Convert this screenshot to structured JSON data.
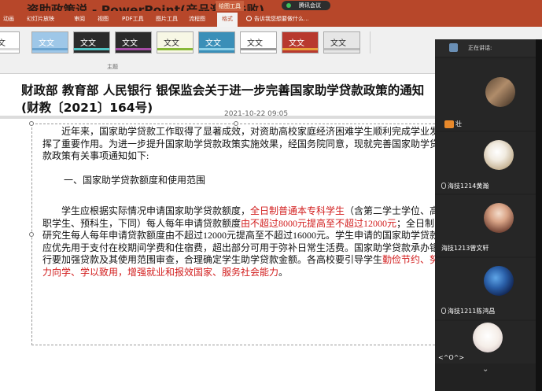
{
  "window": {
    "doc_title": "资助政策说 - PowerPoint(产品激活失败)",
    "context_tab": "绘图工具",
    "meeting_app": "腾讯会议"
  },
  "tabs": [
    {
      "label": "动画"
    },
    {
      "label": "幻灯片放映"
    },
    {
      "label": "审阅"
    },
    {
      "label": "视图"
    },
    {
      "label": "PDF工具"
    },
    {
      "label": "图片工具"
    },
    {
      "label": "流程图"
    },
    {
      "label": "格式"
    }
  ],
  "tell_me": "告诉我您想要做什么...",
  "ribbon": {
    "style_text": "文文",
    "group_label": "主题",
    "styles": [
      {
        "bg": "#ffffff",
        "fg": "#333333",
        "bar": "#d9d9d9"
      },
      {
        "bg": "#9ec7e8",
        "fg": "#ffffff",
        "bar": "#6aa3cf"
      },
      {
        "bg": "#2b2b2b",
        "fg": "#ffffff",
        "bar": "#4fc3c3"
      },
      {
        "bg": "#2b2b2b",
        "fg": "#ffffff",
        "bar": "#a64ca6"
      },
      {
        "bg": "#f7f7e5",
        "fg": "#333333",
        "bar": "#88b838"
      },
      {
        "bg": "#3a8fb8",
        "fg": "#ffffff",
        "bar": "#8cd0e8"
      },
      {
        "bg": "#ffffff",
        "fg": "#333333",
        "bar": "#999999"
      },
      {
        "bg": "#b8392e",
        "fg": "#ffffff",
        "bar": "#e8a03a"
      },
      {
        "bg": "#e6e6e6",
        "fg": "#333333",
        "bar": "#bbbbbb"
      }
    ]
  },
  "document": {
    "title": "财政部 教育部 人民银行 银保监会关于进一步完善国家助学贷款政策的通知(财教〔2021〕164号)",
    "date": "2021-10-22 09:05",
    "para1": "近年来，国家助学贷款工作取得了显著成效，对资助高校家庭经济困难学生顺利完成学业发挥了重要作用。为进一步提升国家助学贷款政策实施效果，经国务院同意，现就完善国家助学贷款政策有关事项通知如下:",
    "section1": "一、国家助学贷款额度和使用范围",
    "p2_a": "学生应根据实际情况申请国家助学贷款额度，",
    "p2_red1": "全日制普通本专科学生",
    "p2_b": "（含第二学士学位、高职学生、预科生，下同）每人每年申请贷款额度",
    "p2_red2": "由不超过8000元提高至不超过12000元",
    "p2_c": "；全日制研究生每人每年申请贷款额度由不超过12000元提高至不超过16000元。学生申请的国家助学贷款应优先用于支付在校期间学费和住宿费，超出部分可用于弥补日常生活费。国家助学贷款承办银行要加强贷款及其使用范围审查，合理确定学生助学贷款金额。各高校要引导学生",
    "p2_red3": "勤俭节约、努力向学、学以致用，增强就业和报效国家、服务社会能力",
    "p2_d": "。"
  },
  "meeting": {
    "speaking_label": "正在讲话:",
    "participants": [
      {
        "name": "壮",
        "avatar": "photo-room"
      },
      {
        "name": "海技1214黄瀚",
        "avatar": "photo-dog"
      },
      {
        "name": "海技1213曾文轩",
        "avatar": "photo-cartoon"
      },
      {
        "name": "海技1211陈鸿昌",
        "avatar": "photo-night"
      },
      {
        "name": "<^O^>",
        "avatar": "photo-drawing"
      }
    ]
  }
}
